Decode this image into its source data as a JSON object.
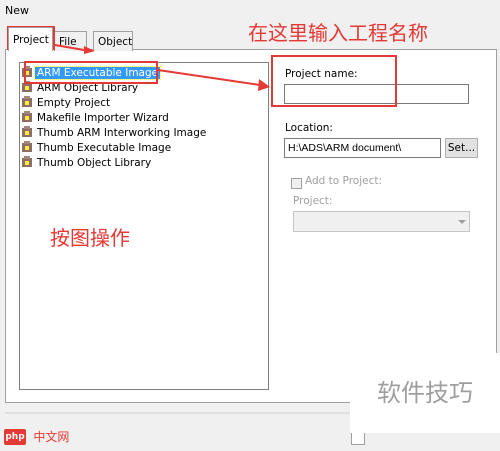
{
  "window": {
    "title": "New"
  },
  "tabs": [
    {
      "label": "Project",
      "selected": true
    },
    {
      "label": "File",
      "selected": false
    },
    {
      "label": "Object",
      "selected": false
    }
  ],
  "project_list": [
    {
      "label": "ARM Executable Image",
      "selected": true
    },
    {
      "label": "ARM Object Library",
      "selected": false
    },
    {
      "label": "Empty Project",
      "selected": false
    },
    {
      "label": "Makefile Importer Wizard",
      "selected": false
    },
    {
      "label": "Thumb ARM Interworking Image",
      "selected": false
    },
    {
      "label": "Thumb Executable Image",
      "selected": false
    },
    {
      "label": "Thumb Object Library",
      "selected": false
    }
  ],
  "form": {
    "project_name_label": "Project name:",
    "project_name_value": "",
    "location_label": "Location:",
    "location_value": "H:\\ADS\\ARM document\\",
    "set_button": "Set...",
    "add_to_project_label": "Add to Project:",
    "add_to_project_checked": false,
    "project_label": "Project:",
    "project_value": ""
  },
  "annotations": {
    "top_right_text": "在这里输入工程名称",
    "left_text": "按图操作",
    "color": "#e53935"
  },
  "watermark": {
    "text": "软件技巧"
  },
  "logo": {
    "php": "php",
    "site": "中文网"
  },
  "icons": {
    "project_item": "project-icon",
    "dropdown": "dropdown-icon",
    "checkbox": "checkbox-icon"
  }
}
